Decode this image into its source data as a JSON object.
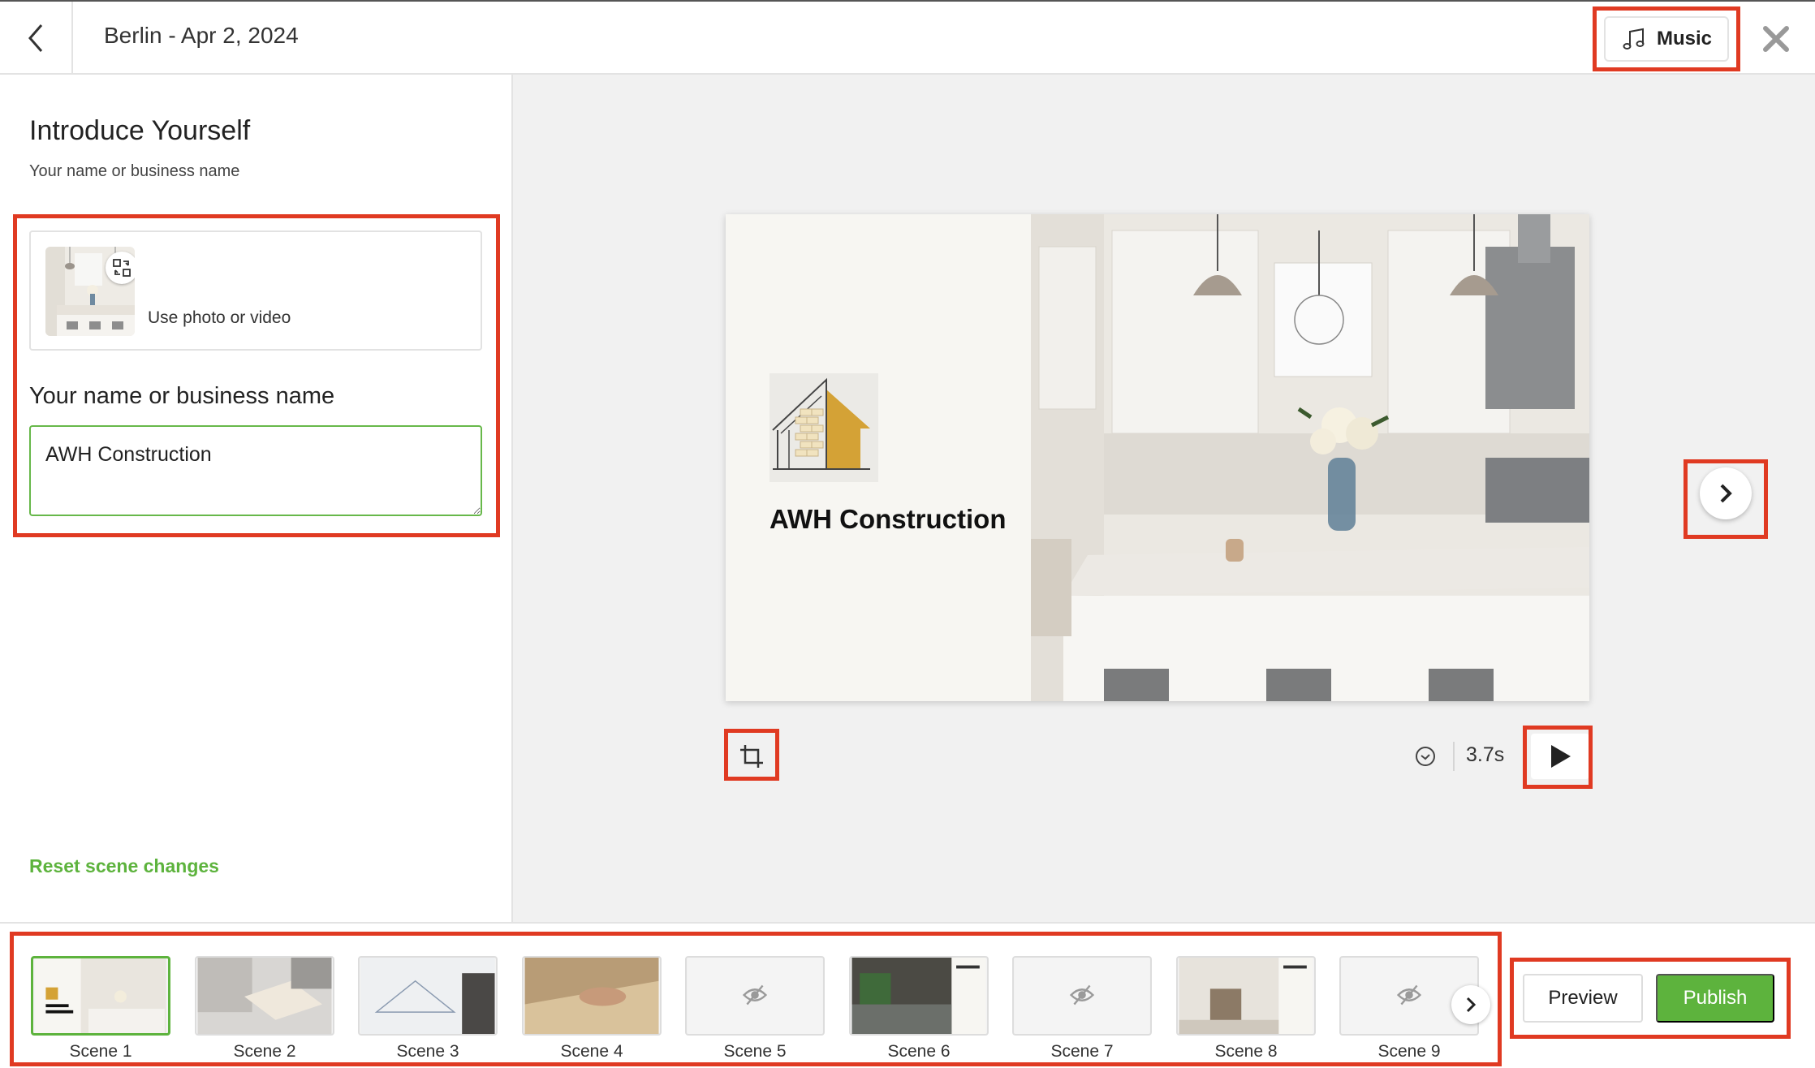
{
  "header": {
    "title": "Berlin - Apr 2, 2024",
    "music_label": "Music",
    "back_icon": "chevron-left-icon",
    "close_icon": "close-icon"
  },
  "panel": {
    "title": "Introduce Yourself",
    "subtitle": "Your name or business name",
    "media_label": "Use photo or video",
    "name_label": "Your name or business name",
    "name_value": "AWH Construction",
    "reset_label": "Reset scene changes"
  },
  "slide": {
    "business_name": "AWH Construction"
  },
  "controls": {
    "duration": "3.7s"
  },
  "scenes": [
    {
      "label": "Scene 1",
      "selected": true,
      "hidden": false
    },
    {
      "label": "Scene 2",
      "selected": false,
      "hidden": false
    },
    {
      "label": "Scene 3",
      "selected": false,
      "hidden": false
    },
    {
      "label": "Scene 4",
      "selected": false,
      "hidden": false
    },
    {
      "label": "Scene 5",
      "selected": false,
      "hidden": true
    },
    {
      "label": "Scene 6",
      "selected": false,
      "hidden": false
    },
    {
      "label": "Scene 7",
      "selected": false,
      "hidden": true
    },
    {
      "label": "Scene 8",
      "selected": false,
      "hidden": false
    },
    {
      "label": "Scene 9",
      "selected": false,
      "hidden": true
    }
  ],
  "actions": {
    "preview_label": "Preview",
    "publish_label": "Publish"
  },
  "colors": {
    "accent": "#5db33d",
    "highlight": "#e03a22"
  }
}
